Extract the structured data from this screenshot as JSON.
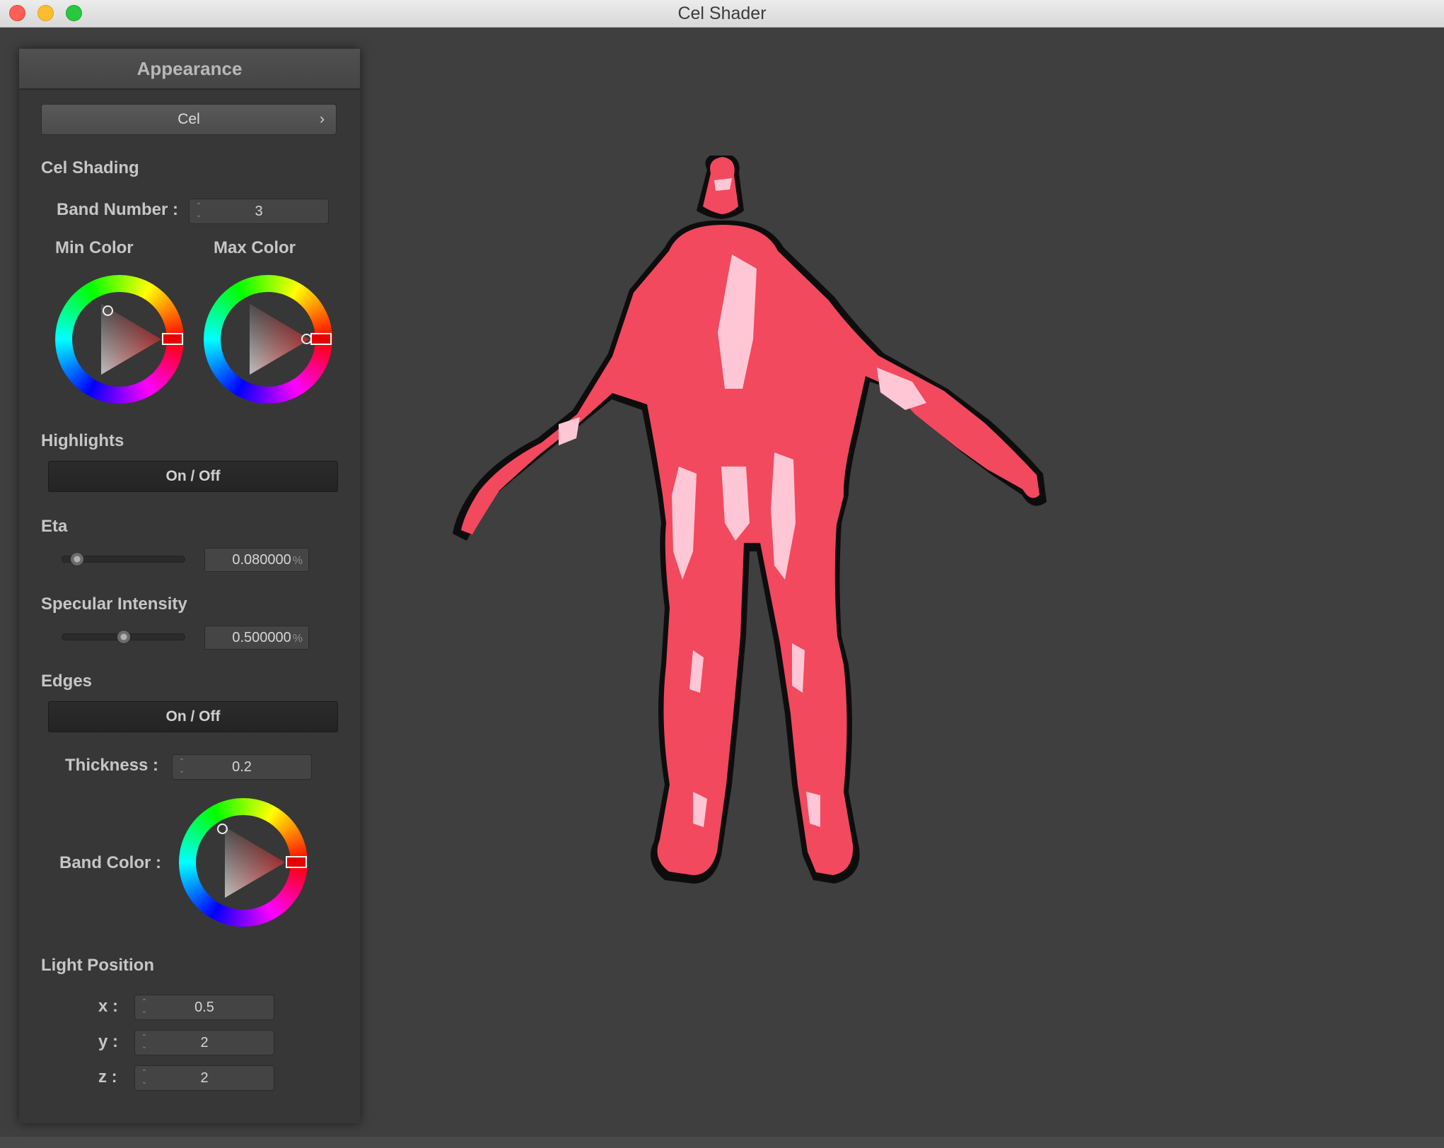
{
  "window": {
    "title": "Cel Shader"
  },
  "panel": {
    "header": "Appearance",
    "mode_button": {
      "label": "Cel",
      "chevron": "›"
    },
    "cel_shading": {
      "title": "Cel Shading",
      "band_number_label": "Band Number :",
      "band_number_value": "3",
      "min_color_label": "Min Color",
      "max_color_label": "Max Color"
    },
    "highlights": {
      "title": "Highlights",
      "toggle_label": "On / Off",
      "eta_title": "Eta",
      "eta_value": "0.080000",
      "eta_unit": "%",
      "eta_fraction": 0.08,
      "specular_title": "Specular Intensity",
      "specular_value": "0.500000",
      "specular_unit": "%",
      "specular_fraction": 0.5
    },
    "edges": {
      "title": "Edges",
      "toggle_label": "On / Off",
      "thickness_label": "Thickness :",
      "thickness_value": "0.2",
      "band_color_label": "Band Color :"
    },
    "light_position": {
      "title": "Light Position",
      "x_label": "x :",
      "x_value": "0.5",
      "y_label": "y :",
      "y_value": "2",
      "z_label": "z :",
      "z_value": "2"
    }
  },
  "colors": {
    "model": "#f2495f",
    "model_highlight": "#ffc7d5",
    "edge": "#0d0d0d",
    "background": "#3f3f3f",
    "selected_hue": "#e60000"
  },
  "icons": {
    "close": "close-icon",
    "minimize": "minimize-icon",
    "zoom": "zoom-icon",
    "chevron": "chevron-right-icon",
    "stepper": "stepper-arrows-icon"
  }
}
